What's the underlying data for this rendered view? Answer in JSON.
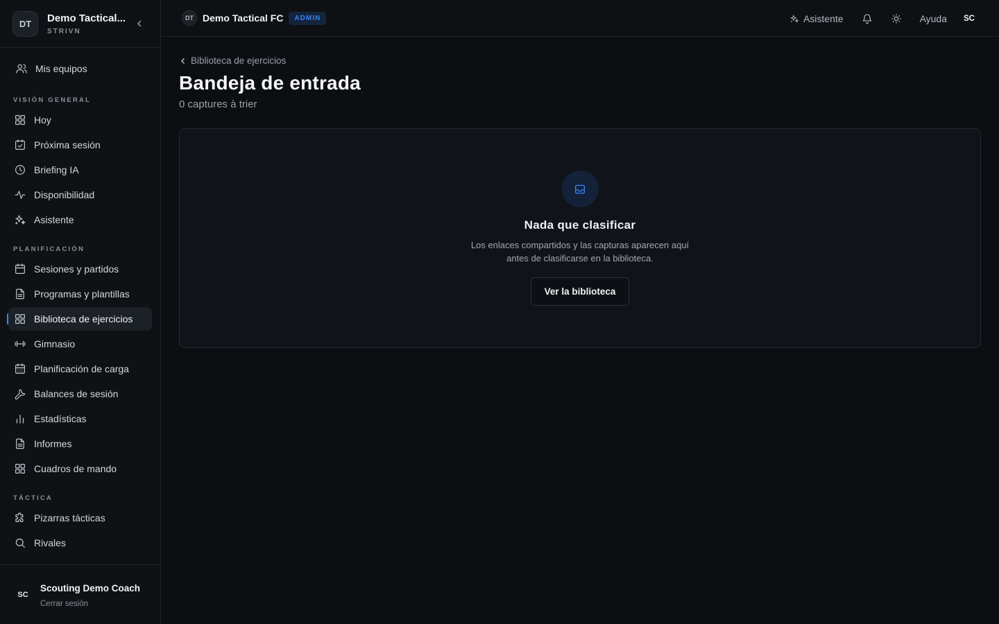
{
  "sidebar": {
    "avatar": "DT",
    "team_name": "Demo Tactical...",
    "team_sub": "STRIVN",
    "my_teams": "Mis equipos",
    "sections": {
      "overview": "VISIÓN GENERAL",
      "planning": "PLANIFICACIÓN",
      "tactics": "TÁCTICA"
    },
    "items": {
      "today": "Hoy",
      "next_session": "Próxima sesión",
      "briefing": "Briefing IA",
      "availability": "Disponibilidad",
      "assistant": "Asistente",
      "sessions": "Sesiones y partidos",
      "programs": "Programas y plantillas",
      "library": "Biblioteca de ejercicios",
      "gym": "Gimnasio",
      "load": "Planificación de carga",
      "balances": "Balances de sesión",
      "stats": "Estadísticas",
      "reports": "Informes",
      "dashboards": "Cuadros de mando",
      "boards": "Pizarras tácticas",
      "rivals": "Rivales"
    },
    "active_item": "library",
    "footer": {
      "avatar": "SC",
      "name": "Scouting Demo Coach",
      "logout": "Cerrar sesión"
    }
  },
  "topbar": {
    "avatar": "DT",
    "team": "Demo Tactical FC",
    "badge": "ADMIN",
    "assistant": "Asistente",
    "help": "Ayuda",
    "user": "SC"
  },
  "main": {
    "breadcrumb": "Biblioteca de ejercicios",
    "title": "Bandeja de entrada",
    "subtitle": "0 captures à trier",
    "empty": {
      "title": "Nada que clasificar",
      "line1": "Los enlaces compartidos y las capturas aparecen aquí",
      "line2": "antes de clasificarse en la biblioteca.",
      "button": "Ver la biblioteca"
    }
  },
  "colors": {
    "accent": "#3b82f6",
    "background": "#0c0e12",
    "card": "#10141a"
  }
}
